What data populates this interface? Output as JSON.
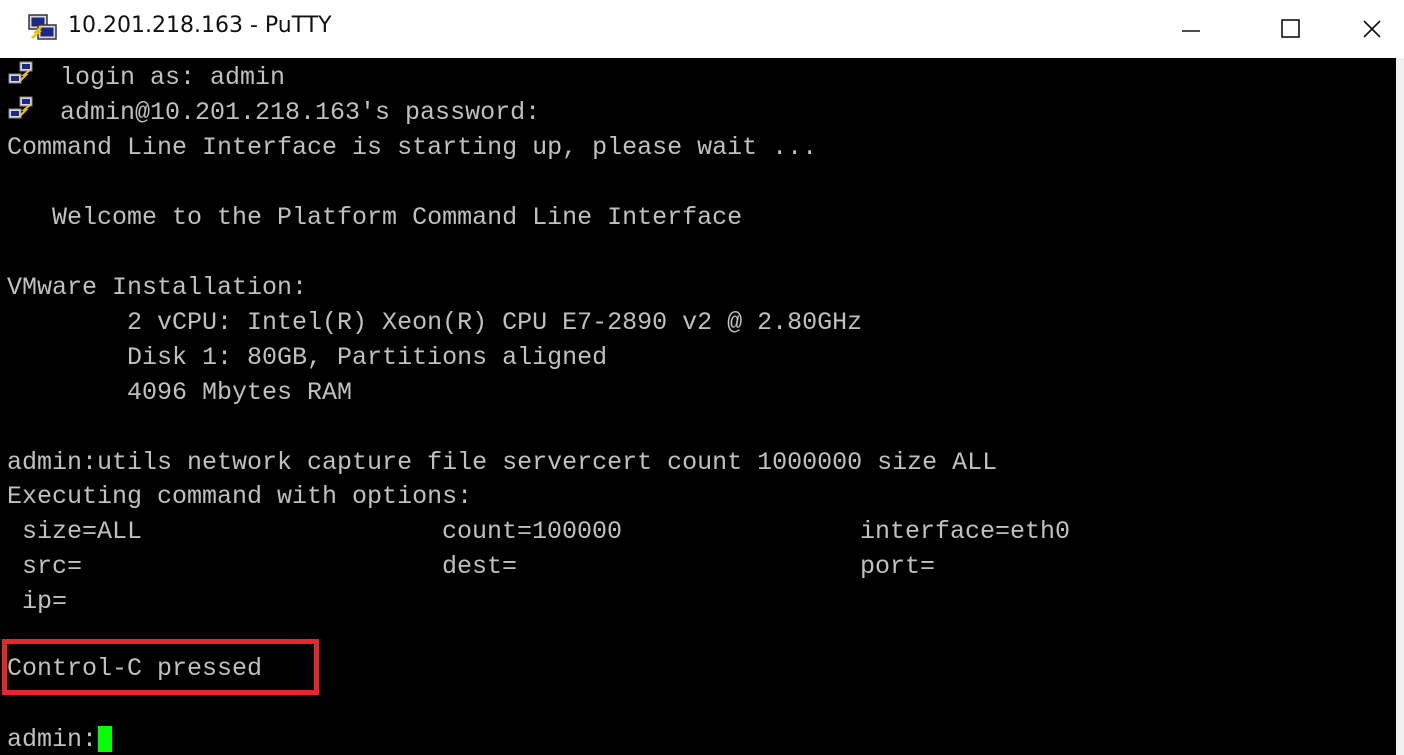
{
  "window": {
    "title": "10.201.218.163 - PuTTY",
    "icon": "putty-icon",
    "controls": {
      "minimize": "minimize-icon",
      "maximize": "maximize-icon",
      "close": "close-icon"
    }
  },
  "terminal": {
    "background": "#000000",
    "foreground": "#c0c0c0",
    "cursor_color": "#00ff00",
    "highlight_color": "#e8262a",
    "lines": {
      "login": "login as: admin",
      "password": "admin@10.201.218.163's password:",
      "starting": "Command Line Interface is starting up, please wait ...",
      "welcome": "   Welcome to the Platform Command Line Interface",
      "vmware": "VMware Installation:",
      "cpu": "        2 vCPU: Intel(R) Xeon(R) CPU E7-2890 v2 @ 2.80GHz",
      "disk": "        Disk 1: 80GB, Partitions aligned",
      "ram": "        4096 Mbytes RAM",
      "command": "admin:utils network capture file servercert count 1000000 size ALL",
      "executing": "Executing command with options:",
      "ctrl_c": "Control-C pressed",
      "prompt": "admin:"
    },
    "options": {
      "size": " size=ALL",
      "count": "count=100000",
      "interface": "interface=eth0",
      "src": " src=",
      "dest": "dest=",
      "port": "port=",
      "ip": " ip="
    }
  }
}
